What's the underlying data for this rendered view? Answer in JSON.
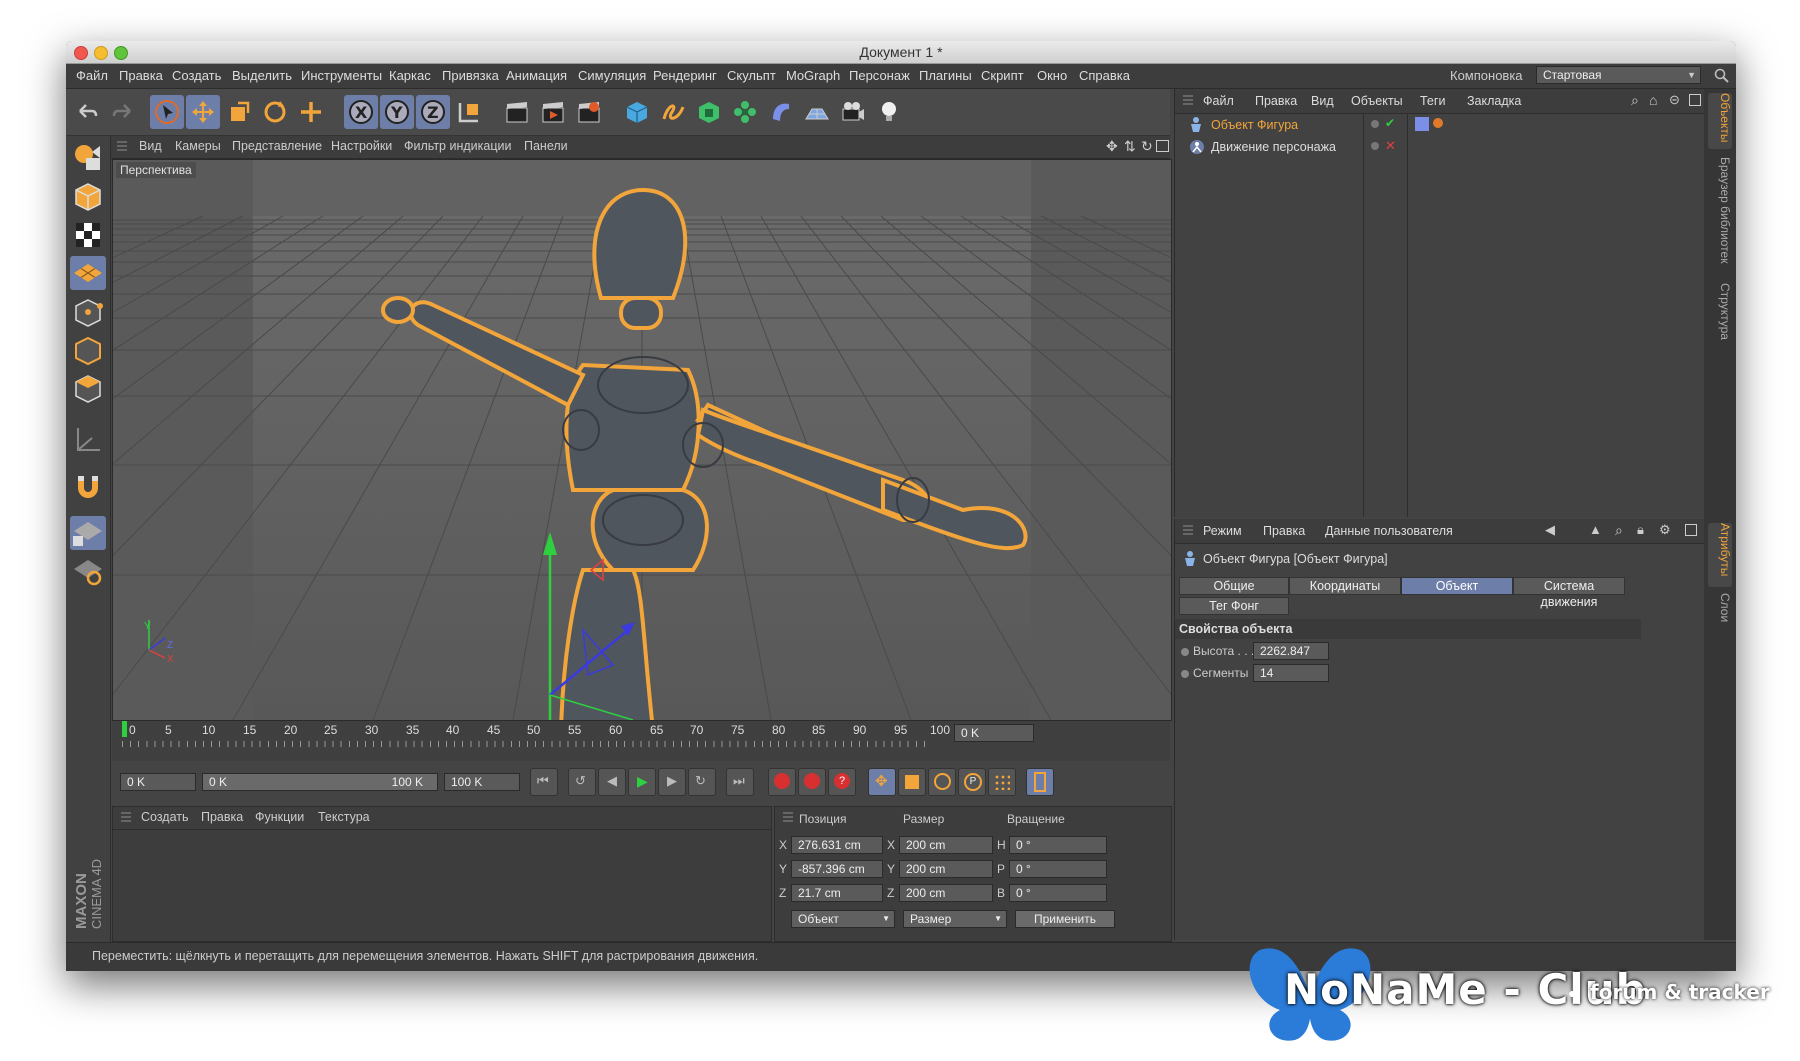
{
  "window": {
    "title": "Документ 1 *"
  },
  "menubar": {
    "items": [
      "Файл",
      "Правка",
      "Создать",
      "Выделить",
      "Инструменты",
      "Каркас",
      "Привязка",
      "Анимация",
      "Симуляция",
      "Рендеринг",
      "Скульпт",
      "MoGraph",
      "Персонаж",
      "Плагины",
      "Скрипт",
      "Окно",
      "Справка"
    ],
    "layout_label": "Компоновка",
    "layout_value": "Стартовая"
  },
  "viewport": {
    "menu": [
      "Вид",
      "Камеры",
      "Представление",
      "Настройки",
      "Фильтр индикации",
      "Панели"
    ],
    "label": "Перспектива",
    "axes": {
      "x": "X",
      "y": "Y",
      "z": "Z"
    }
  },
  "timeline": {
    "ticks": [
      "0",
      "5",
      "10",
      "15",
      "20",
      "25",
      "30",
      "35",
      "40",
      "45",
      "50",
      "55",
      "60",
      "65",
      "70",
      "75",
      "80",
      "85",
      "90",
      "95",
      "100"
    ],
    "current_frame": "0 K"
  },
  "transport": {
    "start": "0 K",
    "range_start": "0 K",
    "range_end": "100 K",
    "end": "100 K"
  },
  "material_panel": {
    "menu": [
      "Создать",
      "Правка",
      "Функции",
      "Текстура"
    ]
  },
  "coordinates": {
    "headers": [
      "Позиция",
      "Размер",
      "Вращение"
    ],
    "rows": [
      {
        "axis": "X",
        "pos": "276.631 cm",
        "size_axis": "X",
        "size": "200 cm",
        "rot_axis": "H",
        "rot": "0 °"
      },
      {
        "axis": "Y",
        "pos": "-857.396 cm",
        "size_axis": "Y",
        "size": "200 cm",
        "rot_axis": "P",
        "rot": "0 °"
      },
      {
        "axis": "Z",
        "pos": "21.7 cm",
        "size_axis": "Z",
        "size": "200 cm",
        "rot_axis": "B",
        "rot": "0 °"
      }
    ],
    "mode_select": "Объект",
    "size_select": "Размер",
    "apply_button": "Применить"
  },
  "object_manager": {
    "menu": [
      "Файл",
      "Правка",
      "Вид",
      "Объекты",
      "Теги",
      "Закладка"
    ],
    "objects": [
      "Объект Фигура",
      "Движение персонажа"
    ]
  },
  "attributes": {
    "menu": [
      "Режим",
      "Правка",
      "Данные пользователя"
    ],
    "title": "Объект Фигура [Объект Фигура]",
    "tabs": [
      "Общие",
      "Координаты",
      "Объект",
      "Система движения",
      "Тег Фонг"
    ],
    "section": "Свойства объекта",
    "height_label": "Высота . . .",
    "height_value": "2262.847",
    "segments_label": "Сегменты",
    "segments_value": "14"
  },
  "side_tabs": [
    "Объекты",
    "Браузер библиотек",
    "Структура",
    "Атрибуты",
    "Слои"
  ],
  "status": "Переместить: щёлкнуть и перетащить для перемещения элементов. Нажать SHIFT для растрирования движения.",
  "brand": {
    "line1": "MAXON",
    "line2": "CINEMA 4D"
  },
  "watermark": {
    "name": "NoNaMe - Club",
    "tagline": "forum & tracker"
  },
  "colors": {
    "accent": "#6d7ea8",
    "selection": "#f2a53a",
    "panel": "#424242",
    "viewport": "#5e5e5e"
  }
}
